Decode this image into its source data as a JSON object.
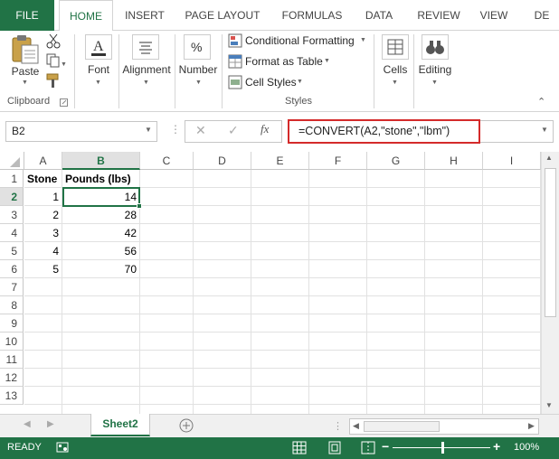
{
  "ribbon_tabs": [
    "FILE",
    "HOME",
    "INSERT",
    "PAGE LAYOUT",
    "FORMULAS",
    "DATA",
    "REVIEW",
    "VIEW",
    "DE"
  ],
  "active_tab": "HOME",
  "clipboard": {
    "paste_label": "Paste",
    "group_label": "Clipboard"
  },
  "font": {
    "label": "Font"
  },
  "alignment": {
    "label": "Alignment"
  },
  "number": {
    "label": "Number"
  },
  "styles": {
    "conditional_formatting": "Conditional Formatting",
    "format_as_table": "Format as Table",
    "cell_styles": "Cell Styles",
    "group_label": "Styles"
  },
  "cells": {
    "label": "Cells"
  },
  "editing": {
    "label": "Editing"
  },
  "formula_bar": {
    "name_box": "B2",
    "fx_label": "fx",
    "formula": "=CONVERT(A2,\"stone\",\"lbm\")"
  },
  "grid": {
    "columns": [
      "A",
      "B",
      "C",
      "D",
      "E",
      "F",
      "G",
      "H",
      "I"
    ],
    "selected_column": "B",
    "rows": [
      "1",
      "2",
      "3",
      "4",
      "5",
      "6",
      "7",
      "8",
      "9",
      "10",
      "11",
      "12",
      "13"
    ],
    "selected_row": "2",
    "headers": {
      "A1": "Stone",
      "B1": "Pounds (lbs)"
    },
    "data": [
      {
        "a": "1",
        "b": "14"
      },
      {
        "a": "2",
        "b": "28"
      },
      {
        "a": "3",
        "b": "42"
      },
      {
        "a": "4",
        "b": "56"
      },
      {
        "a": "5",
        "b": "70"
      }
    ]
  },
  "sheets": {
    "active": "Sheet2",
    "add_icon": "plus-circle-icon"
  },
  "status": {
    "ready": "READY",
    "zoom": "100%"
  },
  "colors": {
    "excel_green": "#217346",
    "highlight_red": "#d42a2a"
  }
}
